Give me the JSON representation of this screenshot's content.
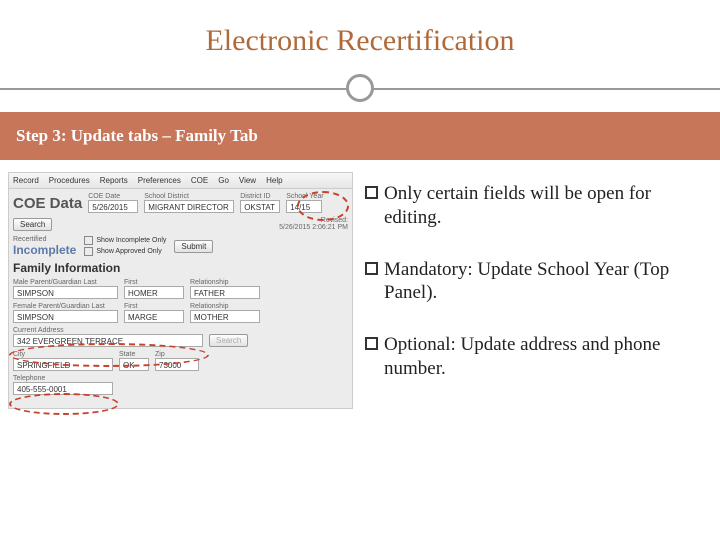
{
  "title": "Electronic Recertification",
  "step_bar": "Step 3: Update tabs – Family Tab",
  "bullets": [
    "Only certain fields will be open for editing.",
    "Mandatory: Update School Year (Top Panel).",
    "Optional: Update address and phone number."
  ],
  "screenshot": {
    "menu": [
      "Record",
      "Procedures",
      "Reports",
      "Preferences",
      "COE",
      "Go",
      "View",
      "Help"
    ],
    "big_label": "COE Data",
    "search_btn": "Search",
    "coe_date": {
      "label": "COE Date",
      "value": "5/26/2015"
    },
    "school_district": {
      "label": "School District",
      "value": "MIGRANT DIRECTOR"
    },
    "district_id": {
      "label": "District ID",
      "value": "OKSTAT"
    },
    "school_year": {
      "label": "School Year",
      "value": "14/15"
    },
    "revised_label": "Revised:",
    "revised_value": "5/26/2015 2:06:21 PM",
    "recertified_label": "Recertified",
    "incomplete": "Incomplete",
    "show_incomplete": "Show Incomplete Only",
    "show_approved": "Show Approved Only",
    "submit_btn": "Submit",
    "family_info": "Family Information",
    "male_guardian": {
      "last_label": "Male Parent/Guardian Last",
      "last": "SIMPSON",
      "first_label": "First",
      "first": "HOMER",
      "rel_label": "Relationship",
      "rel": "FATHER"
    },
    "female_guardian": {
      "last_label": "Female Parent/Guardian Last",
      "last": "SIMPSON",
      "first_label": "First",
      "first": "MARGE",
      "rel_label": "Relationship",
      "rel": "MOTHER"
    },
    "current_address_label": "Current Address",
    "current_address": "342 EVERGREEN TERRACE",
    "update_search_btn": "Search",
    "city": {
      "label": "City",
      "value": "SPRINGFIELD"
    },
    "state": {
      "label": "State",
      "value": "OK"
    },
    "zip": {
      "label": "Zip",
      "value": "73000"
    },
    "telephone": {
      "label": "Telephone",
      "value": "405-555-0001"
    }
  }
}
